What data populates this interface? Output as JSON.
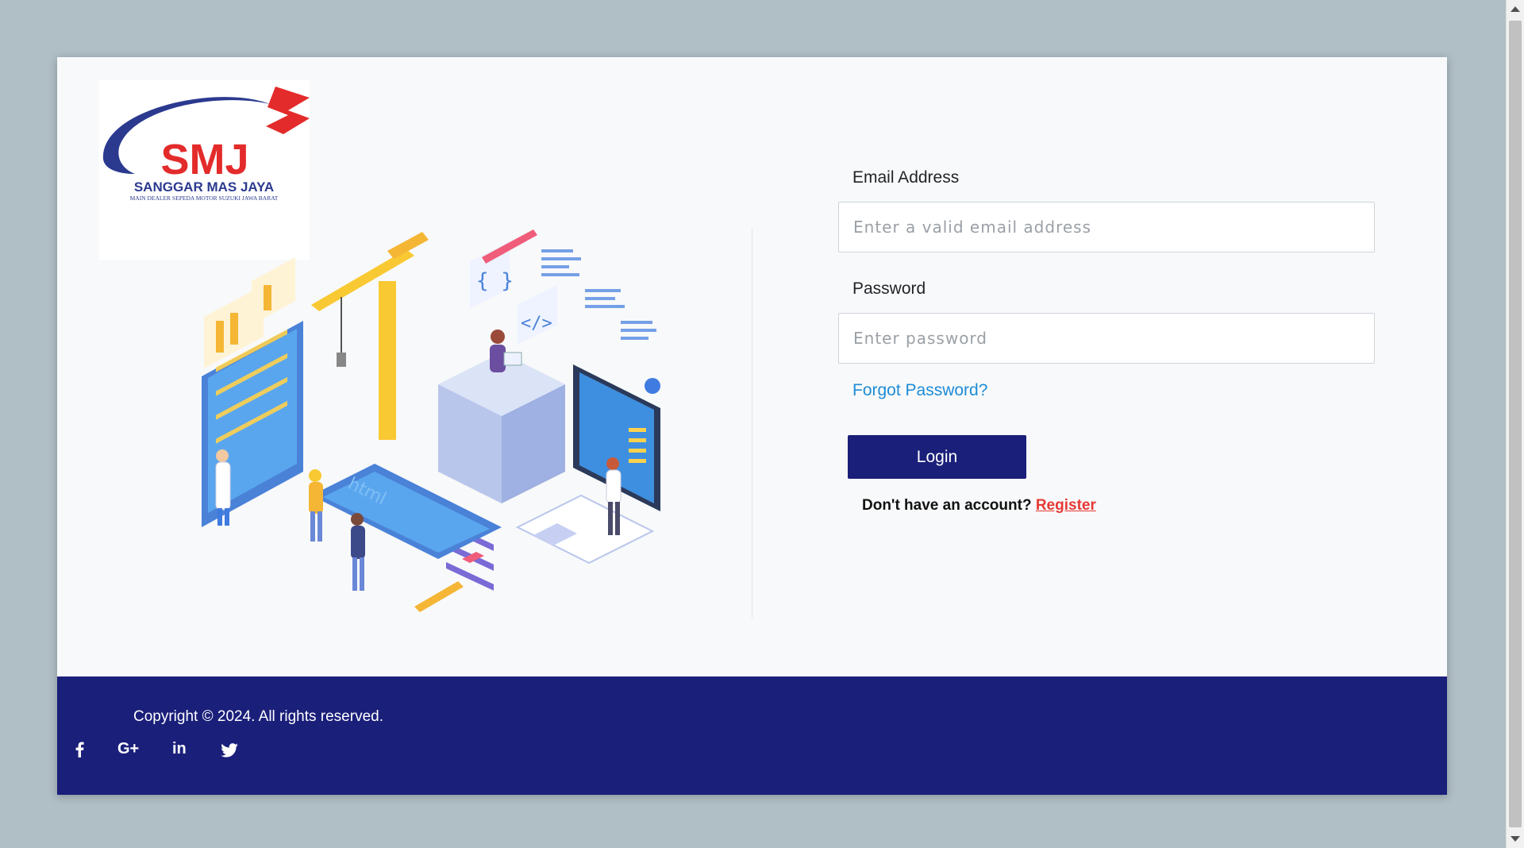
{
  "logo": {
    "initials": "SMJ",
    "name": "SANGGAR MAS JAYA",
    "tagline": "MAIN DEALER SEPEDA MOTOR SUZUKI JAWA BARAT",
    "colors": {
      "red": "#e32b2b",
      "blue": "#2b3a8f"
    }
  },
  "illustration": {
    "code_braces": "{ }",
    "code_tag": "</>",
    "html_text": "html"
  },
  "form": {
    "email_label": "Email Address",
    "email_placeholder": "Enter a valid email address",
    "password_label": "Password",
    "password_placeholder": "Enter password",
    "forgot_link": "Forgot Password?",
    "login_button": "Login",
    "register_prompt": "Don't have an account?",
    "register_link": "Register"
  },
  "footer": {
    "copyright": "Copyright © 2024. All rights reserved.",
    "social_icons": [
      "facebook-icon",
      "google-plus-icon",
      "linkedin-icon",
      "twitter-icon"
    ],
    "google_plus_text": "G+",
    "linkedin_text": "in"
  },
  "colors": {
    "background": "#b0bec5",
    "card": "#f8f9fa",
    "primary": "#1a1f7a",
    "link": "#1d8cd6",
    "register": "#e53935"
  }
}
